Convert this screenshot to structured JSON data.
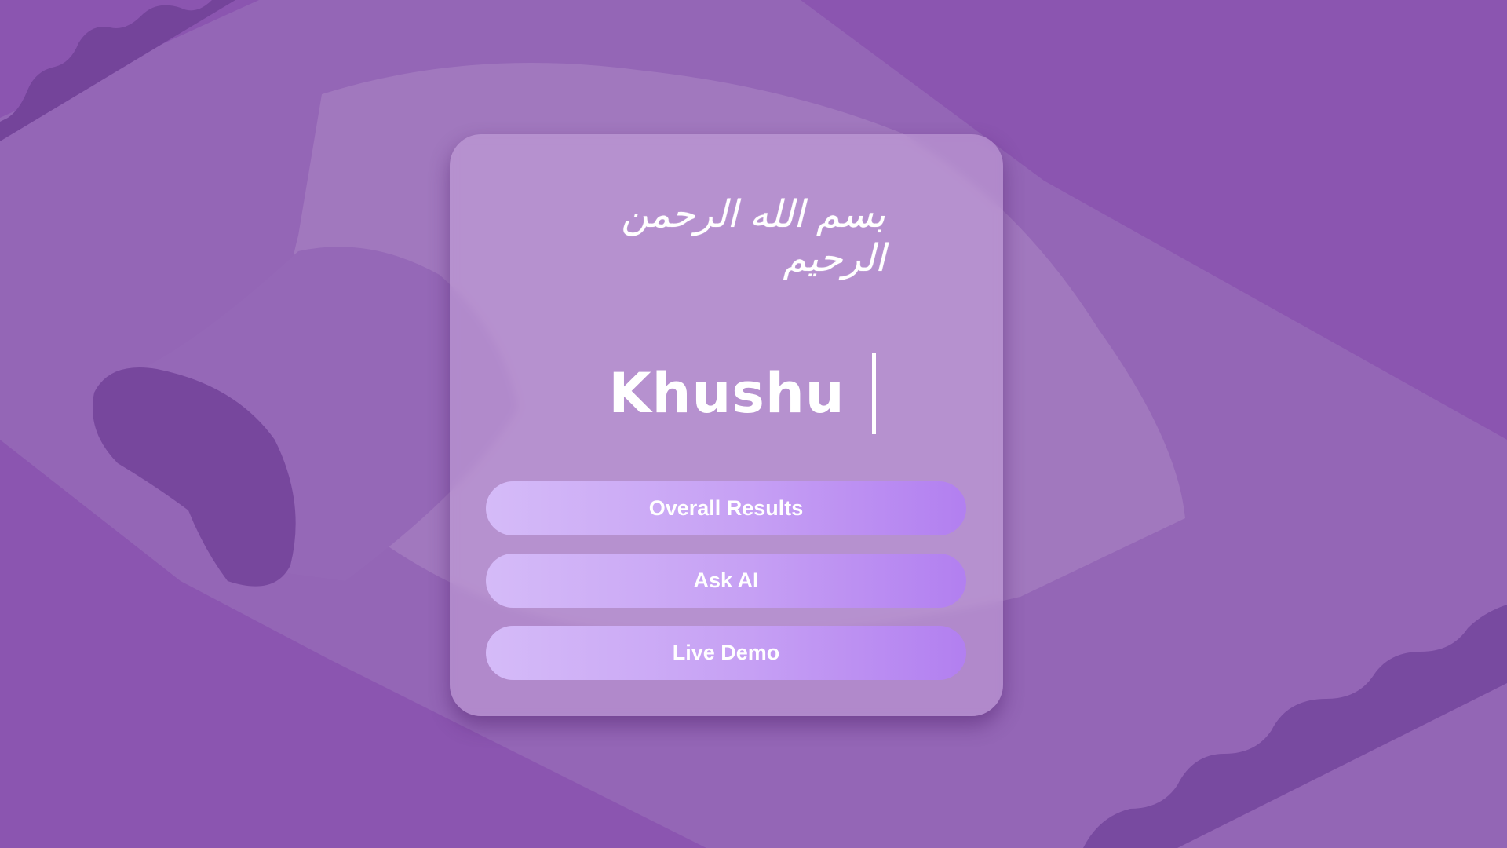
{
  "theme": {
    "background": "#8b55b0",
    "card_tint": "#c8a5dc",
    "button_gradient": [
      "#d5bbf8",
      "#c6a0f4",
      "#b27ff0"
    ],
    "text_color": "#ffffff"
  },
  "card": {
    "bismillah": "بسم الله الرحمن الرحيم",
    "title": "Khushu",
    "cursor_icon": "text-cursor"
  },
  "actions": [
    {
      "label": "Overall Results"
    },
    {
      "label": "Ask AI"
    },
    {
      "label": "Live Demo"
    }
  ]
}
